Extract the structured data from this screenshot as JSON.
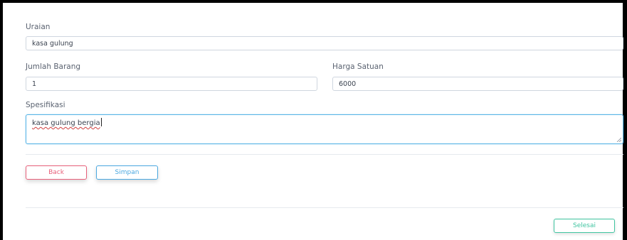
{
  "form": {
    "uraian": {
      "label": "Uraian",
      "value": "kasa gulung"
    },
    "jumlah_barang": {
      "label": "Jumlah Barang",
      "value": "1"
    },
    "harga_satuan": {
      "label": "Harga Satuan",
      "value": "6000"
    },
    "spesifikasi": {
      "label": "Spesifikasi",
      "value": "kasa gulung bergia"
    }
  },
  "actions": {
    "back_label": "Back",
    "simpan_label": "Simpan",
    "selesai_label": "Selesai"
  },
  "colors": {
    "back": "#e8607a",
    "simpan": "#4aa8e0",
    "selesai": "#3fc4a0",
    "focus_border": "#58b4e6"
  }
}
